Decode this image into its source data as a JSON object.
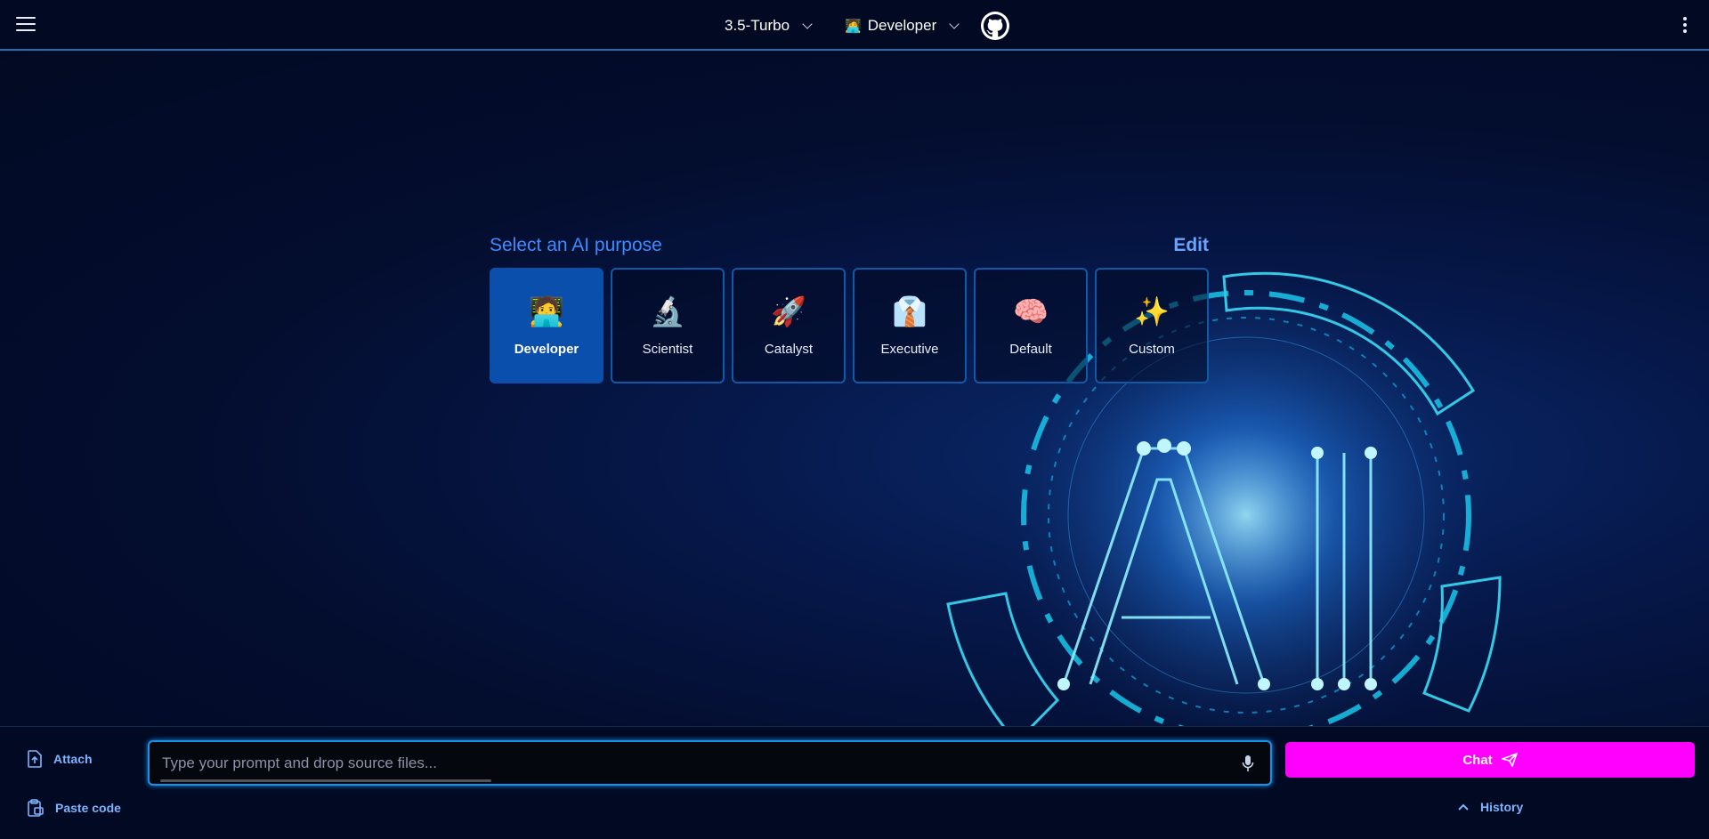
{
  "header": {
    "model_label": "3.5-Turbo",
    "persona_icon": "🧑‍💻",
    "persona_label": "Developer",
    "github_icon": "github-icon"
  },
  "purpose": {
    "title": "Select an AI purpose",
    "edit_label": "Edit",
    "cards": [
      {
        "emoji": "🧑‍💻",
        "label": "Developer",
        "active": true
      },
      {
        "emoji": "🔬",
        "label": "Scientist",
        "active": false
      },
      {
        "emoji": "🚀",
        "label": "Catalyst",
        "active": false
      },
      {
        "emoji": "👔",
        "label": "Executive",
        "active": false
      },
      {
        "emoji": "🧠",
        "label": "Default",
        "active": false
      },
      {
        "emoji": "✨",
        "label": "Custom",
        "active": false
      }
    ]
  },
  "footer": {
    "attach_label": "Attach",
    "paste_label": "Paste code",
    "prompt_placeholder": "Type your prompt and drop source files...",
    "chat_label": "Chat",
    "history_label": "History"
  },
  "colors": {
    "accent": "#3e8bff",
    "active_card": "#0b4fad",
    "chat_button": "#ff00ff",
    "background": "#020a23"
  }
}
